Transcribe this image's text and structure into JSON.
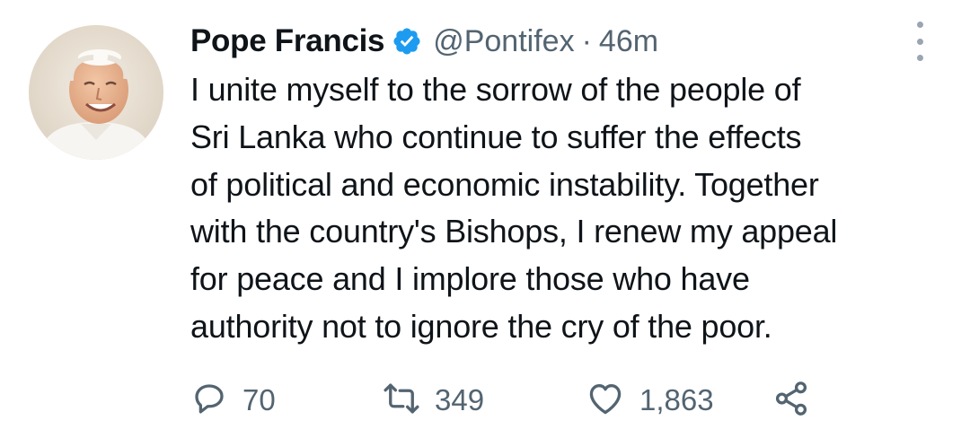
{
  "tweet": {
    "author": {
      "display_name": "Pope Francis",
      "handle": "@Pontifex",
      "verified": true
    },
    "separator": "·",
    "time": "46m",
    "text_lines": [
      "I unite myself to the sorrow of the people of",
      "Sri Lanka who continue to suffer the effects",
      "of political and economic instability. Together",
      "with the country's Bishops, I renew my appeal",
      "for peace and I implore those who have",
      "authority not to ignore the cry of the poor."
    ],
    "metrics": {
      "replies": "70",
      "retweets": "349",
      "likes": "1,863"
    }
  },
  "icons": {
    "verified": "verified-badge-icon",
    "more": "more-vertical-icon",
    "reply": "reply-icon",
    "retweet": "retweet-icon",
    "like": "heart-icon",
    "share": "share-icon"
  },
  "colors": {
    "text_primary": "#0f1419",
    "text_secondary": "#536471",
    "verified_blue": "#1d9bf0"
  }
}
